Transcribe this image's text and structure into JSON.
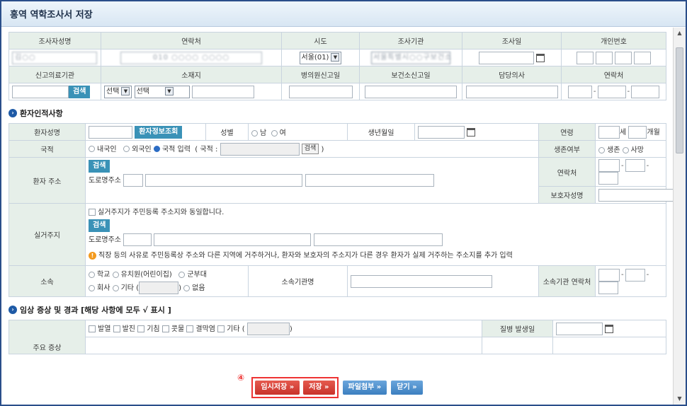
{
  "window": {
    "title": "홍역 역학조사서 저장"
  },
  "reporter": {
    "headers": [
      "조사자성명",
      "연락처",
      "시도",
      "조사기관",
      "조사일",
      "개인번호"
    ],
    "name_value": "김○○",
    "phone_value": "010 ○○○○ ○○○○",
    "sido_value": "서울(01)",
    "agency_value": "서울특별시○○구보건소",
    "headers2": [
      "신고의료기관",
      "소재지",
      "병의원신고일",
      "보건소신고일",
      "담당의사",
      "연락처"
    ],
    "search_label": "검색",
    "select1": "선택",
    "select2": "선택"
  },
  "patient_section": {
    "title": "환자인적사항",
    "name_label": "환자성명",
    "lookup_button": "환자정보조회",
    "sex_label": "성별",
    "sex_male": "남",
    "sex_female": "여",
    "birth_label": "생년월일",
    "age_label": "연령",
    "age_unit_year": "세",
    "age_unit_month": "개월",
    "nation_label": "국적",
    "nation_domestic": "내국인",
    "nation_foreign": "외국인",
    "nation_input": "국적 입력",
    "nation_prefix": "( 국적 :",
    "nation_search": "검색",
    "nation_suffix": ")",
    "survival_label": "생존여부",
    "survival_alive": "생존",
    "survival_dead": "사망",
    "address_label": "환자 주소",
    "search_label": "검색",
    "road_label": "도로명주소",
    "contact_label": "연락처",
    "guardian_label": "보호자성명",
    "residence_label": "실거주지",
    "residence_check": "실거주지가 주민등록 주소지와 동일합니다.",
    "residence_note": "직장 등의 사유로 주민등록상 주소와 다른 지역에 거주하거나, 환자와 보호자의 주소지가 다른 경우 환자가 실제 거주하는 주소지를 추가 입력",
    "affil_label": "소속",
    "affil_school": "학교",
    "affil_kinder": "유치원(어린이집)",
    "affil_army": "군부대",
    "affil_company": "회사",
    "affil_other": "기타 (",
    "affil_other_close": ")",
    "affil_none": "없음",
    "affil_org_label": "소속기관명",
    "affil_contact_label": "소속기관 연락처"
  },
  "clinical_section": {
    "title": "임상 증상 및 경과 [해당 사항에 모두 √ 표시 ]",
    "symptoms": [
      "발열",
      "발진",
      "기침",
      "콧물",
      "결막염"
    ],
    "other_label": "기타 (",
    "other_close": ")",
    "onset_label": "질병 발생일",
    "main_label": "주요 증상"
  },
  "footer": {
    "marker": "④",
    "temp_save": "임시저장 »",
    "save": "저장 »",
    "attach": "파일첨부 »",
    "close": "닫기 »"
  }
}
